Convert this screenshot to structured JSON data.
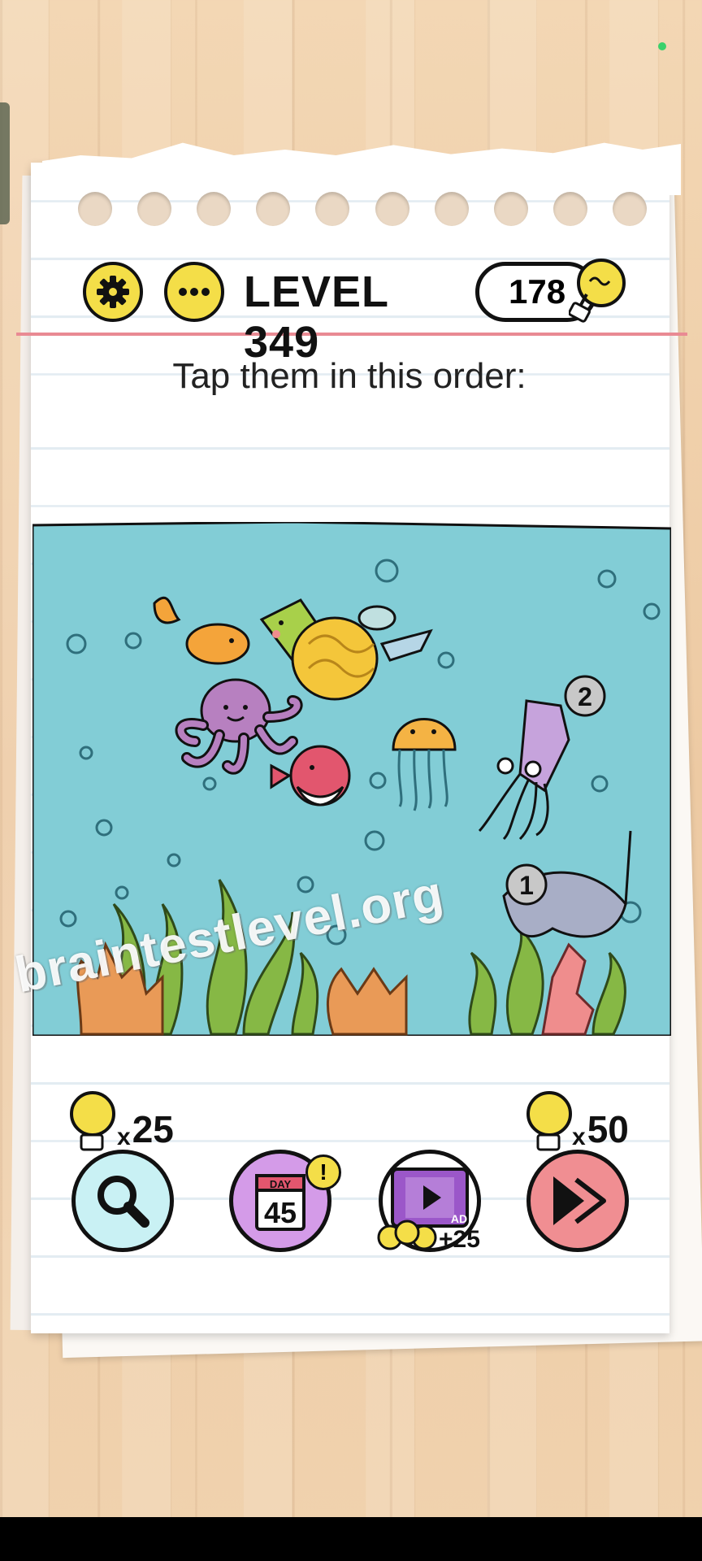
{
  "header": {
    "level_label": "LEVEL 349",
    "hint_count": "178",
    "settings_icon": "gear-icon",
    "menu_icon": "more-dots-icon"
  },
  "puzzle": {
    "instruction": "Tap them in this order:",
    "badges": [
      {
        "number": "2",
        "attached_to": "squid"
      },
      {
        "number": "1",
        "attached_to": "stingray"
      }
    ],
    "creatures": [
      "goldfish",
      "angelfish",
      "sea-turtle",
      "fish",
      "octopus",
      "pufferfish",
      "jellyfish",
      "squid",
      "stingray"
    ]
  },
  "watermark": "braintestlevel.org",
  "toolbar": {
    "search_cost": "25",
    "skip_cost": "50",
    "cost_prefix": "x",
    "daily_day": "45",
    "daily_header": "DAY",
    "daily_alert": "!",
    "ad_label": "AD",
    "ad_bonus": "+25"
  },
  "colors": {
    "water": "#82cdd6",
    "yellow": "#f4de48",
    "search_bg": "#c9f1f4",
    "daily_bg": "#d49be8",
    "skip_bg": "#f08e92",
    "film": "#9b57c9"
  }
}
